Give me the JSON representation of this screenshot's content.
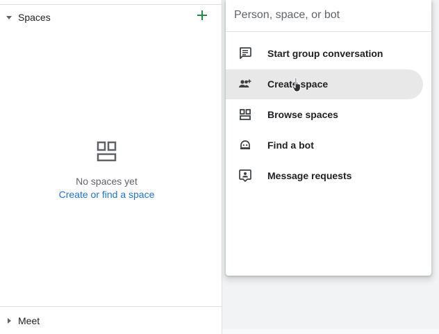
{
  "spaces": {
    "title": "Spaces",
    "add_icon": "plus-icon",
    "empty_icon": "spaces-grid-icon",
    "empty_title": "No spaces yet",
    "empty_link": "Create or find a space"
  },
  "meet": {
    "title": "Meet"
  },
  "menu": {
    "search_placeholder": "Person, space, or bot",
    "items": [
      {
        "label": "Start group conversation",
        "icon": "chat-bubble-icon"
      },
      {
        "label": "Create space",
        "icon": "group-add-icon",
        "active": true
      },
      {
        "label": "Browse spaces",
        "icon": "spaces-grid-icon"
      },
      {
        "label": "Find a bot",
        "icon": "bot-icon"
      },
      {
        "label": "Message requests",
        "icon": "person-message-icon"
      }
    ]
  },
  "colors": {
    "accent_green": "#1e8e3e",
    "link_blue": "#1a73e8",
    "icon_gray": "#5f6368",
    "active_bg": "#e8e8e8"
  }
}
